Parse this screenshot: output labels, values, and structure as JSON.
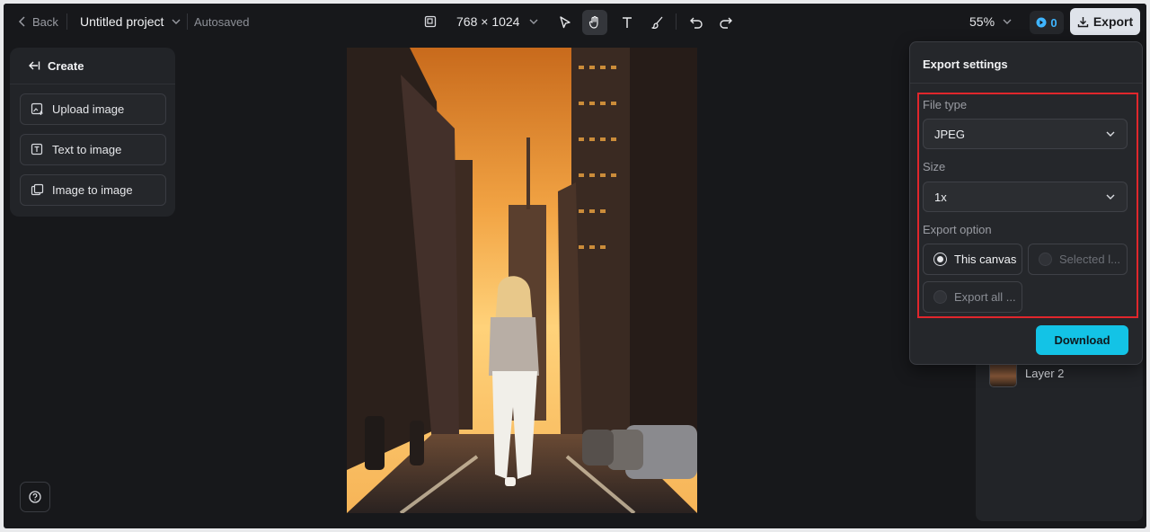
{
  "topbar": {
    "back_label": "Back",
    "project_name": "Untitled project",
    "save_status": "Autosaved",
    "canvas_size": "768 × 1024",
    "zoom": "55%",
    "credits": "0",
    "export_label": "Export"
  },
  "left_panel": {
    "title": "Create",
    "buttons": [
      {
        "label": "Upload image",
        "icon": "upload-image-icon"
      },
      {
        "label": "Text to image",
        "icon": "text-to-image-icon"
      },
      {
        "label": "Image to image",
        "icon": "image-to-image-icon"
      }
    ]
  },
  "layers": {
    "items": [
      {
        "label": "Layer 2"
      }
    ]
  },
  "export_settings": {
    "title": "Export settings",
    "file_type_label": "File type",
    "file_type_value": "JPEG",
    "size_label": "Size",
    "size_value": "1x",
    "export_option_label": "Export option",
    "options": [
      {
        "label": "This canvas",
        "selected": true,
        "enabled": true
      },
      {
        "label": "Selected l...",
        "selected": false,
        "enabled": false
      },
      {
        "label": "Export all ...",
        "selected": false,
        "enabled": false
      }
    ],
    "download_label": "Download"
  },
  "colors": {
    "accent": "#13c3e6",
    "highlight_border": "#e0262c",
    "app_bg": "#17181b",
    "panel_bg": "#222428"
  }
}
